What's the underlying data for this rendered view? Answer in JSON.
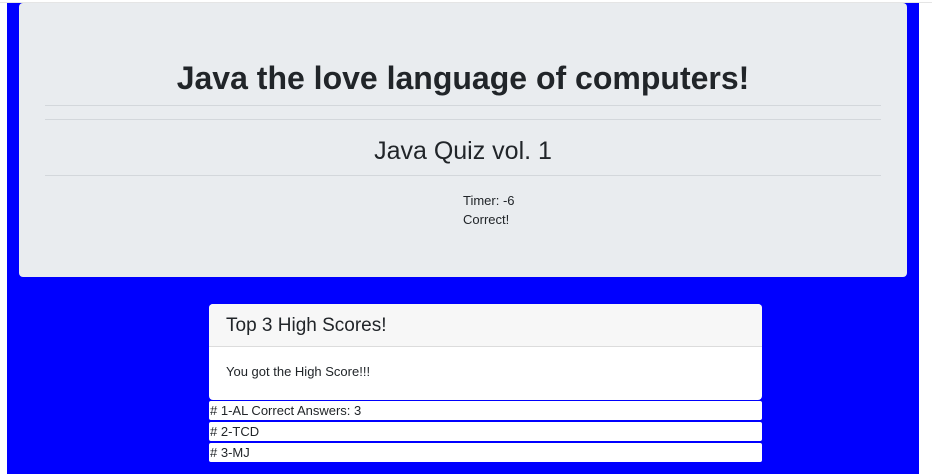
{
  "header": {
    "title": "Java the love language of computers!",
    "subtitle": "Java Quiz vol. 1"
  },
  "status": {
    "timer": "Timer: -6",
    "result": "Correct!"
  },
  "high_scores": {
    "heading": "Top 3 High Scores!",
    "message": "You got the High Score!!!",
    "entries": [
      "# 1-AL Correct Answers: 3",
      "# 2-TCD",
      "# 3-MJ"
    ]
  },
  "colors": {
    "page_background": "#0000ff",
    "jumbotron_background": "#e9ecef",
    "card_background": "#ffffff"
  }
}
